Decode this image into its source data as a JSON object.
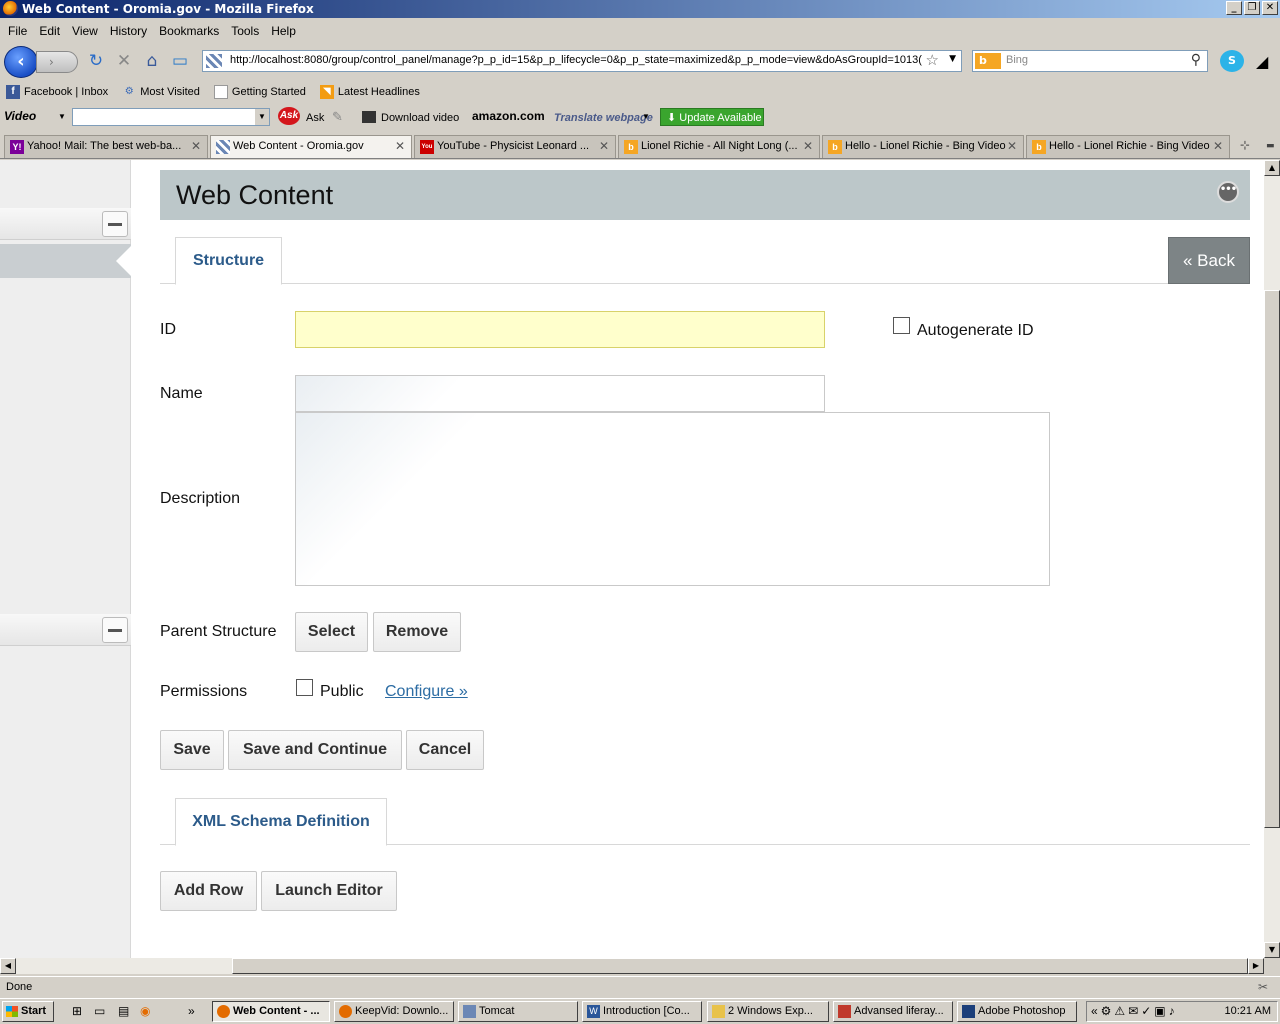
{
  "window": {
    "title": "Web Content - Oromia.gov - Mozilla Firefox"
  },
  "menu": [
    "File",
    "Edit",
    "View",
    "History",
    "Bookmarks",
    "Tools",
    "Help"
  ],
  "nav": {
    "url": "http://localhost:8080/group/control_panel/manage?p_p_id=15&p_p_lifecycle=0&p_p_state=maximized&p_p_mode=view&doAsGroupId=1013(",
    "search_placeholder": "Bing",
    "search_engine": "b"
  },
  "bookmarks": [
    "Facebook | Inbox",
    "Most Visited",
    "Getting Started",
    "Latest Headlines"
  ],
  "toolbar": {
    "video": "Video",
    "ask_logo": "Ask",
    "ask": "Ask",
    "download": "Download video",
    "amazon": "amazon.com",
    "translate": "Translate webpage",
    "update": "Update Available"
  },
  "tabs": [
    {
      "label": "Yahoo! Mail: The best web-ba...",
      "icon": "Y!",
      "color": "#7b0099"
    },
    {
      "label": "Web Content - Oromia.gov",
      "icon": "",
      "color": "#6b87b5"
    },
    {
      "label": "YouTube - Physicist Leonard ...",
      "icon": "You",
      "color": "#cc0000"
    },
    {
      "label": "Lionel Richie - All Night Long (...",
      "icon": "b",
      "color": "#f5a623"
    },
    {
      "label": "Hello - Lionel Richie - Bing Video",
      "icon": "b",
      "color": "#f5a623"
    },
    {
      "label": "Hello - Lionel Richie - Bing Video",
      "icon": "b",
      "color": "#f5a623"
    }
  ],
  "portlet": {
    "title": "Web Content",
    "tab_structure": "Structure",
    "back": "« Back",
    "labels": {
      "id": "ID",
      "autogenerate": "Autogenerate ID",
      "name": "Name",
      "description": "Description",
      "parent_structure": "Parent Structure",
      "permissions": "Permissions",
      "public": "Public",
      "configure": "Configure »"
    },
    "buttons": {
      "select": "Select",
      "remove": "Remove",
      "save": "Save",
      "save_continue": "Save and Continue",
      "cancel": "Cancel",
      "add_row": "Add Row",
      "launch_editor": "Launch Editor"
    },
    "tab_xsd": "XML Schema Definition"
  },
  "status": {
    "text": "Done"
  },
  "taskbar": {
    "start": "Start",
    "tasks": [
      {
        "label": "Web Content - ...",
        "color": "#e36b00"
      },
      {
        "label": "KeepVid: Downlo...",
        "color": "#e36b00"
      },
      {
        "label": "Tomcat",
        "color": "#6b87b5"
      },
      {
        "label": "Introduction [Co...",
        "color": "#2a5699"
      },
      {
        "label": "2 Windows Exp...",
        "color": "#e8c24a"
      },
      {
        "label": "Advansed liferay...",
        "color": "#c0392b"
      },
      {
        "label": "Adobe Photoshop",
        "color": "#1c3f7a"
      }
    ],
    "clock": "10:21 AM"
  }
}
